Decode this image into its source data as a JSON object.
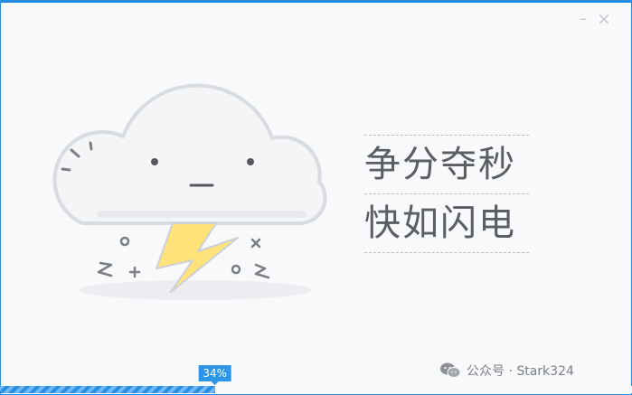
{
  "window": {
    "minimize_icon": "minimize-icon",
    "close_icon": "close-icon",
    "minimize_glyph": "–",
    "close_glyph": "×",
    "accent_color": "#2a8fe0"
  },
  "illustration": {
    "icon": "cloud-lightning-icon",
    "bolt_color": "#ffe27a"
  },
  "slogan": {
    "line1": "争分夺秒",
    "line2": "快如闪电"
  },
  "progress": {
    "value": 0.34,
    "label": "34%"
  },
  "watermark": {
    "icon": "wechat-icon",
    "text": "公众号 · Stark324"
  }
}
